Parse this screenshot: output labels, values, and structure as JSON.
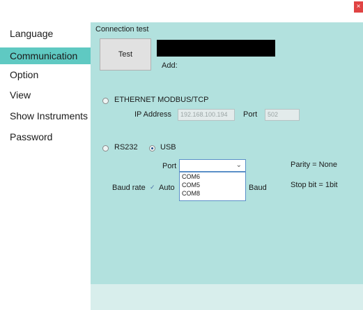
{
  "window": {
    "close_icon": "close-icon"
  },
  "sidebar": {
    "items": [
      {
        "label": "Language"
      },
      {
        "label": "Communication"
      },
      {
        "label": "Option"
      },
      {
        "label": "View"
      },
      {
        "label": "Show Instruments"
      },
      {
        "label": "Password"
      }
    ],
    "active_index": 1
  },
  "connection_test": {
    "title": "Connection test",
    "test_button": "Test",
    "add_label": "Add:"
  },
  "ethernet": {
    "label": "ETHERNET MODBUS/TCP",
    "selected": false,
    "ip_label": "IP Address",
    "ip_value": "192.168.100.194",
    "port_label": "Port",
    "port_value": "502"
  },
  "serial": {
    "rs232_label": "RS232",
    "rs232_selected": false,
    "usb_label": "USB",
    "usb_selected": true,
    "port_label": "Port",
    "port_value": "",
    "port_options": [
      "COM6",
      "COM5",
      "COM8"
    ],
    "baud_rate_label": "Baud rate",
    "auto_label": "Auto",
    "auto_checked": true,
    "baud_label": "Baud",
    "parity_text": "Parity = None",
    "stop_bit_text": "Stop bit = 1bit"
  },
  "colors": {
    "accent": "#5fc9c2",
    "panel": "#b2e1de",
    "close": "#e04343"
  }
}
